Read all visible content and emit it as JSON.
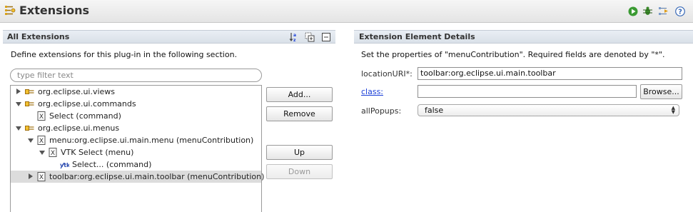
{
  "header": {
    "title": "Extensions",
    "icon": "extensions-icon",
    "actions": [
      "run-icon",
      "debug-icon",
      "export-wizard-icon",
      "help-icon"
    ]
  },
  "left": {
    "title": "All Extensions",
    "description": "Define extensions for this plug-in in the following section.",
    "filter_placeholder": "type filter text",
    "toolbar": [
      "sort-icon",
      "expand-all-icon",
      "collapse-all-icon"
    ],
    "tree": [
      {
        "label": "org.eclipse.ui.views",
        "icon": "extension-point-icon",
        "twisty": "right",
        "depth": 0
      },
      {
        "label": "org.eclipse.ui.commands",
        "icon": "extension-point-icon",
        "twisty": "down",
        "depth": 0
      },
      {
        "label": "Select (command)",
        "icon": "element-icon",
        "twisty": "",
        "depth": 1
      },
      {
        "label": "org.eclipse.ui.menus",
        "icon": "extension-point-icon",
        "twisty": "down",
        "depth": 0
      },
      {
        "label": "menu:org.eclipse.ui.main.menu (menuContribution)",
        "icon": "element-icon",
        "twisty": "down",
        "depth": 1
      },
      {
        "label": "VTK Select (menu)",
        "icon": "element-icon",
        "twisty": "down",
        "depth": 2
      },
      {
        "label": "Select... (command)",
        "icon": "command-icon",
        "twisty": "",
        "depth": 3
      },
      {
        "label": "toolbar:org.eclipse.ui.main.toolbar (menuContribution)",
        "icon": "element-icon",
        "twisty": "right",
        "depth": 1,
        "selected": true
      }
    ],
    "buttons": {
      "add": "Add...",
      "remove": "Remove",
      "up": "Up",
      "down": "Down"
    }
  },
  "right": {
    "title": "Extension Element Details",
    "description": "Set the properties of \"menuContribution\". Required fields are denoted by \"*\".",
    "fields": {
      "location_label": "locationURI*:",
      "location_value": "toolbar:org.eclipse.ui.main.toolbar",
      "class_label": "class:",
      "class_value": "",
      "browse": "Browse...",
      "popups_label": "allPopups:",
      "popups_value": "false"
    }
  }
}
